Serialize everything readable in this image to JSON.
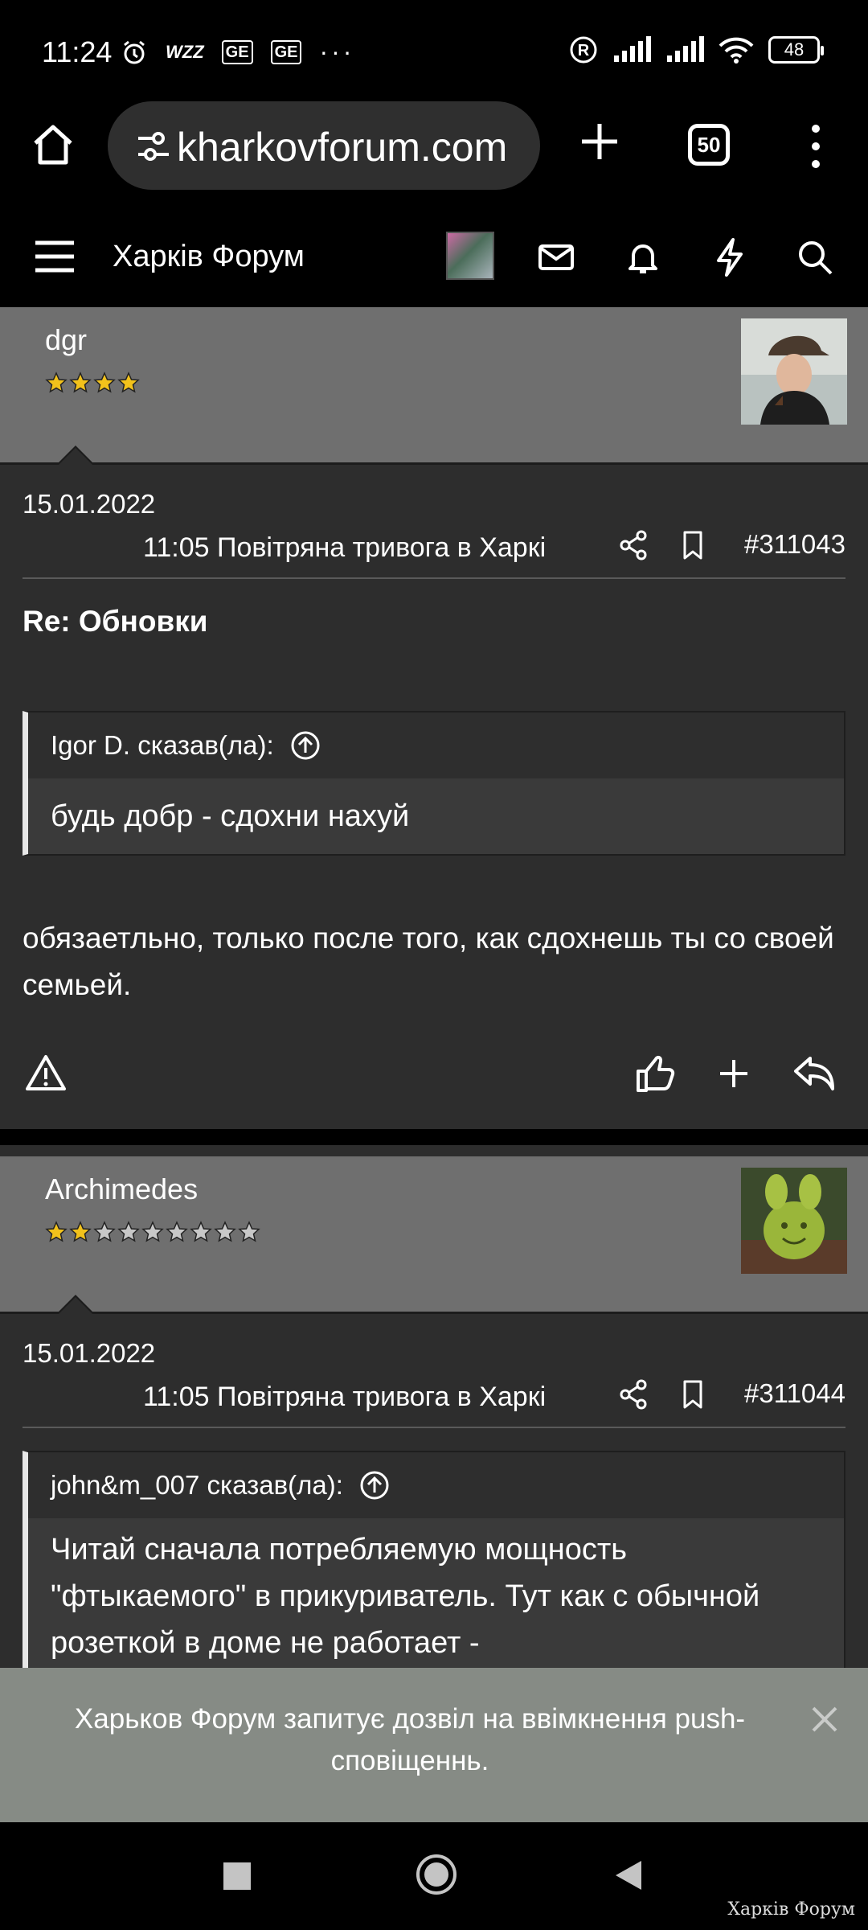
{
  "status_bar": {
    "time": "11:24",
    "icons_left": [
      "alarm-icon",
      "wzz-icon",
      "ge-badge",
      "ge-badge",
      "more-dots"
    ],
    "badge_ge": "GE",
    "wzz": "WZZ",
    "dots": "···",
    "registered": "R",
    "battery": "48"
  },
  "browser": {
    "url": "kharkovforum.com",
    "tab_count": "50"
  },
  "forum": {
    "title": "Харків Форум"
  },
  "posts": [
    {
      "author": "dgr",
      "stars_filled": 4,
      "stars_total": 4,
      "date": "15.01.2022",
      "meta": "11:05 Повітряна тривога в Харкі",
      "number": "#311043",
      "title": "Re: Обновки",
      "quote_author": "Igor D. сказав(ла):",
      "quote_text": "будь добр - сдохни нахуй",
      "message": "обязаетльно, только после того, как сдохнешь ты со своей семьей."
    },
    {
      "author": "Archimedes",
      "stars_filled": 2,
      "stars_total": 9,
      "date": "15.01.2022",
      "meta": "11:05 Повітряна тривога в Харкі",
      "number": "#311044",
      "quote_author": "john&m_007 сказав(ла):",
      "quote_text": "Читай сначала потребляемую мощность \"фтыкаемого\" в прикуриватель. Тут как с обычной розеткой в доме не работает -"
    }
  ],
  "push_notice": {
    "text": "Харьков Форум запитує дозвіл на ввімкнення push-сповіщеннь."
  },
  "watermark": "Харків Форум",
  "colors": {
    "page_bg": "#2d2d2d",
    "post_header_bg": "#6f6f6f",
    "push_bg": "#868b85",
    "star_gold": "#f2c21b",
    "star_grey": "#c8c8c8"
  }
}
